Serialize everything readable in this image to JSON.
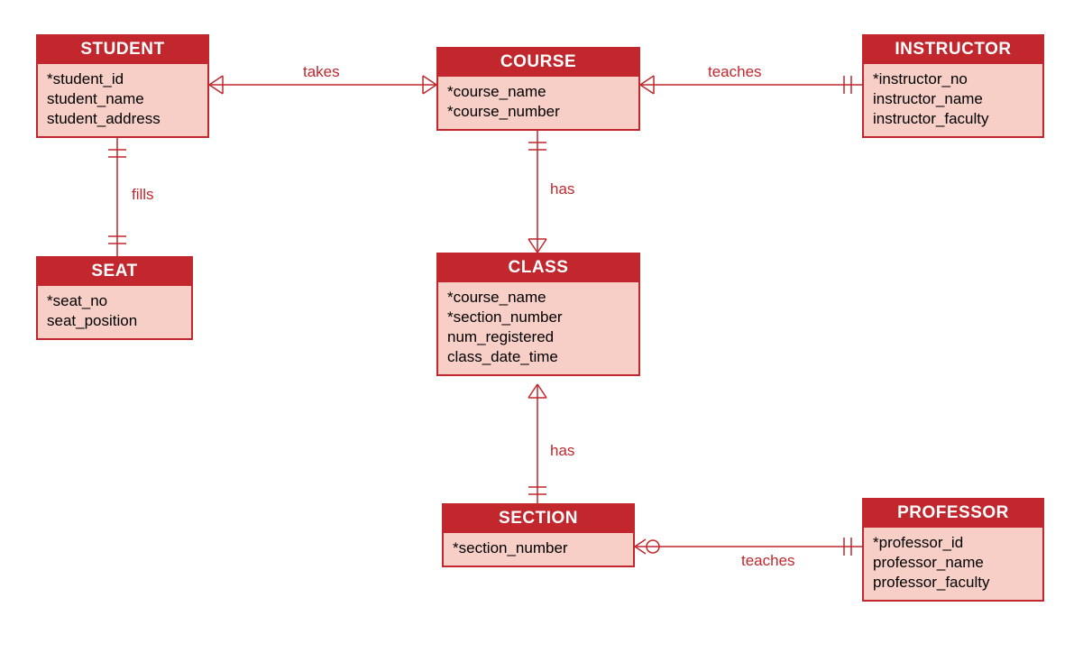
{
  "entities": {
    "student": {
      "title": "STUDENT",
      "attrs": [
        "*student_id",
        "student_name",
        "student_address"
      ]
    },
    "course": {
      "title": "COURSE",
      "attrs": [
        "*course_name",
        "*course_number"
      ]
    },
    "instructor": {
      "title": "INSTRUCTOR",
      "attrs": [
        "*instructor_no",
        "instructor_name",
        "instructor_faculty"
      ]
    },
    "seat": {
      "title": "SEAT",
      "attrs": [
        "*seat_no",
        "seat_position"
      ]
    },
    "class": {
      "title": "CLASS",
      "attrs": [
        "*course_name",
        "*section_number",
        "num_registered",
        "class_date_time"
      ]
    },
    "section": {
      "title": "SECTION",
      "attrs": [
        "*section_number"
      ]
    },
    "professor": {
      "title": "PROFESSOR",
      "attrs": [
        "*professor_id",
        "professor_name",
        "professor_faculty"
      ]
    }
  },
  "relationships": {
    "takes": "takes",
    "teaches_instr": "teaches",
    "fills": "fills",
    "has_course_class": "has",
    "has_class_section": "has",
    "teaches_prof": "teaches"
  },
  "colors": {
    "line": "#c1272d",
    "fill": "#f7cfc7",
    "header": "#c1272d"
  }
}
